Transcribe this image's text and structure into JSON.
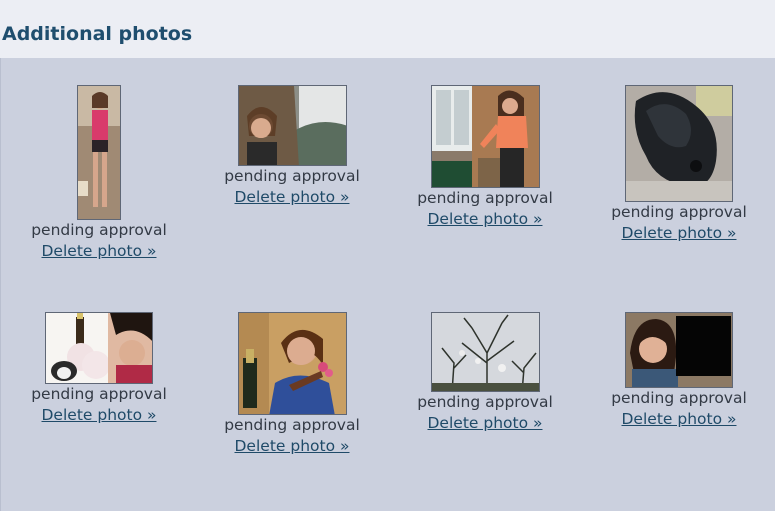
{
  "section": {
    "title": "Additional photos"
  },
  "photos": [
    {
      "status": "pending approval",
      "delete_label": "Delete photo »",
      "subject": "woman in pink top full length"
    },
    {
      "status": "pending approval",
      "delete_label": "Delete photo »",
      "subject": "woman at coastal cliffs"
    },
    {
      "status": "pending approval",
      "delete_label": "Delete photo »",
      "subject": "woman in orange top by sign"
    },
    {
      "status": "pending approval",
      "delete_label": "Delete photo »",
      "subject": "black dog"
    },
    {
      "status": "pending approval",
      "delete_label": "Delete photo »",
      "subject": "dog toy and woman with bottle"
    },
    {
      "status": "pending approval",
      "delete_label": "Delete photo »",
      "subject": "woman with bottle and flowers"
    },
    {
      "status": "pending approval",
      "delete_label": "Delete photo »",
      "subject": "bare tree against sky"
    },
    {
      "status": "pending approval",
      "delete_label": "Delete photo »",
      "subject": "woman smiling with dark square"
    }
  ],
  "colors": {
    "panel_background": "#cbd0de",
    "header_background": "#eceef4",
    "title": "#1f4e6e",
    "link": "#1f4a68"
  }
}
